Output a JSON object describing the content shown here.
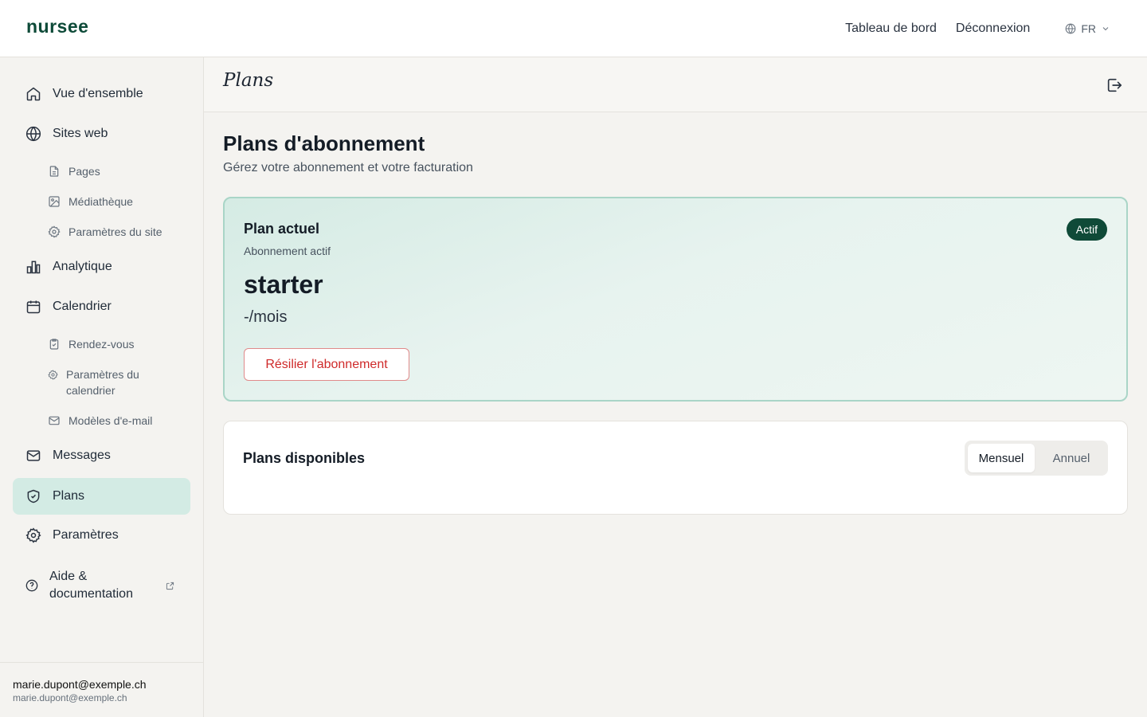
{
  "brand": "nursee",
  "topnav": {
    "dashboard": "Tableau de bord",
    "logout": "Déconnexion",
    "language": "FR"
  },
  "sidebar": {
    "items": [
      {
        "label": "Vue d'ensemble",
        "icon": "home-icon"
      },
      {
        "label": "Sites web",
        "icon": "globe-icon"
      },
      {
        "label": "Analytique",
        "icon": "bar-chart-icon"
      },
      {
        "label": "Calendrier",
        "icon": "calendar-icon"
      },
      {
        "label": "Messages",
        "icon": "mail-icon"
      },
      {
        "label": "Plans",
        "icon": "shield-check-icon",
        "active": true
      },
      {
        "label": "Paramètres",
        "icon": "gear-icon"
      },
      {
        "label": "Aide & documentation",
        "icon": "help-circle-icon"
      }
    ],
    "site_subitems": [
      {
        "label": "Pages",
        "icon": "file-icon"
      },
      {
        "label": "Médiathèque",
        "icon": "image-icon"
      },
      {
        "label": "Paramètres du site",
        "icon": "gear-icon"
      }
    ],
    "calendar_subitems": [
      {
        "label": "Rendez-vous",
        "icon": "clipboard-check-icon"
      },
      {
        "label": "Paramètres du calendrier",
        "icon": "gear-icon"
      },
      {
        "label": "Modèles d'e-mail",
        "icon": "mail-icon"
      }
    ],
    "user": {
      "name": "marie.dupont@exemple.ch",
      "email": "marie.dupont@exemple.ch"
    }
  },
  "page": {
    "header_title": "Plans",
    "title": "Plans d'abonnement",
    "subtitle": "Gérez votre abonnement et votre facturation"
  },
  "current_plan": {
    "title": "Plan actuel",
    "status_text": "Abonnement actif",
    "badge": "Actif",
    "plan_name": "starter",
    "price": "-/mois",
    "cancel_label": "Résilier l'abonnement"
  },
  "available_plans": {
    "title": "Plans disponibles",
    "billing_options": [
      "Mensuel",
      "Annuel"
    ],
    "selected": "Mensuel"
  },
  "colors": {
    "brand": "#0d4a38",
    "active_nav_bg": "#d3ebe4",
    "danger": "#cf2a2a",
    "badge_bg": "#0f4a38"
  }
}
